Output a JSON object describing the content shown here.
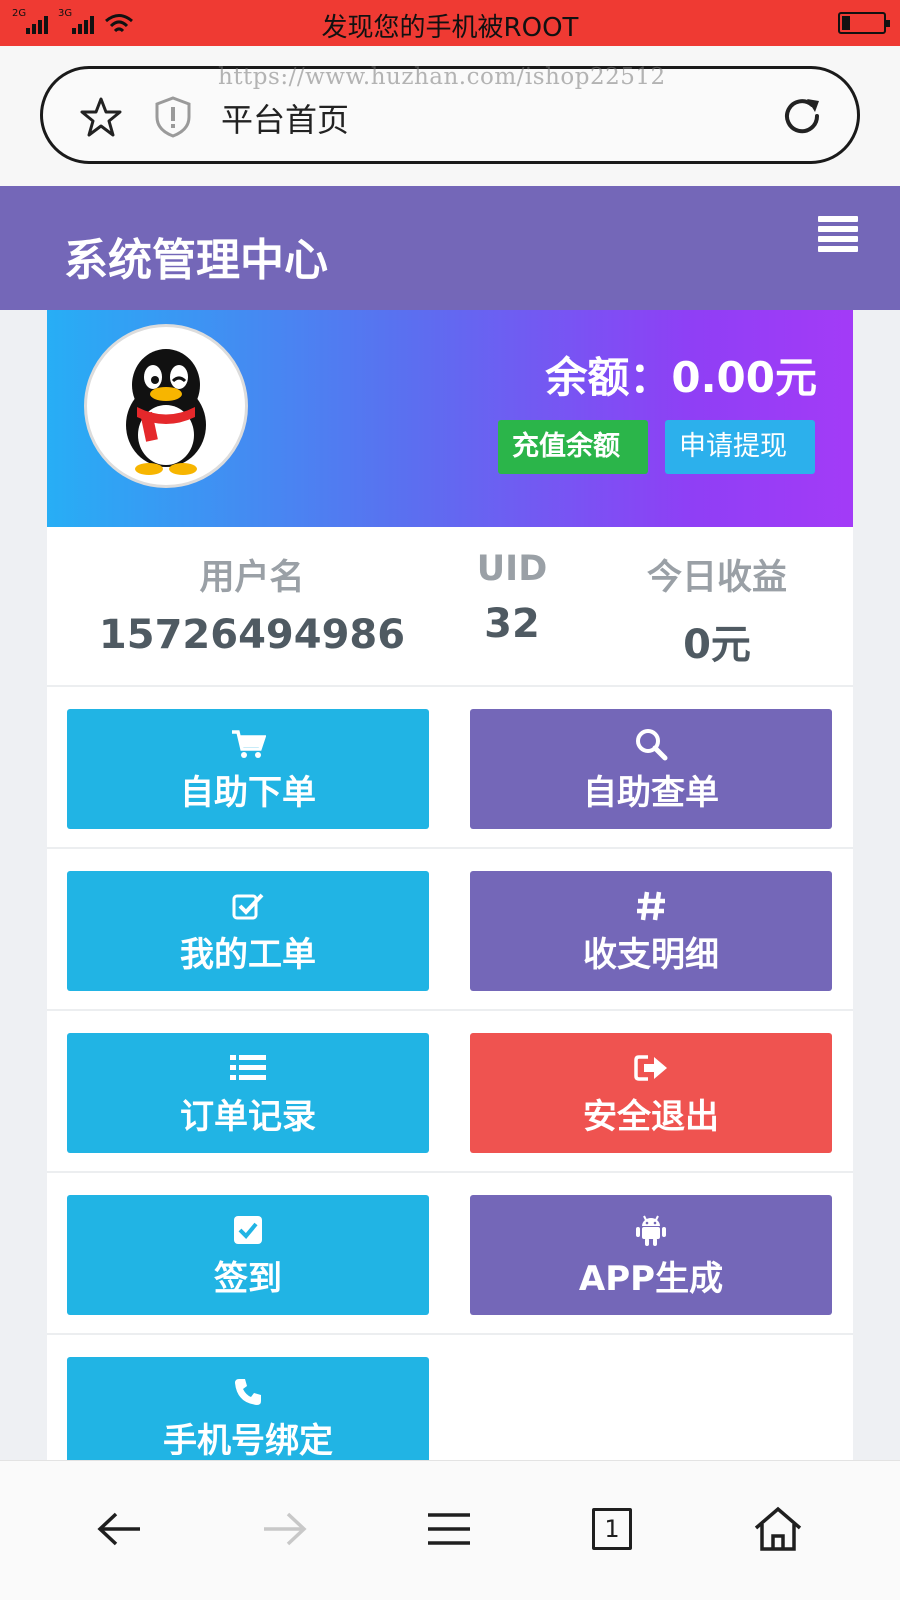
{
  "status_bar": {
    "signal1_tag": "2G",
    "signal2_tag": "3G",
    "notice": "发现您的手机被ROOT"
  },
  "browser": {
    "watermark": "https://www.huzhan.com/ishop22512",
    "page_title": "平台首页"
  },
  "app": {
    "title": "系统管理中心"
  },
  "profile": {
    "balance_label": "余额：0.00元",
    "recharge_label": "充值余额",
    "withdraw_label": "申请提现"
  },
  "stats": {
    "username_label": "用户名",
    "username_value": "15726494986",
    "uid_label": "UID",
    "uid_value": "32",
    "income_label": "今日收益",
    "income_value": "0元"
  },
  "tiles": [
    {
      "label": "自助下单",
      "icon": "cart-icon",
      "color": "#21b4e4"
    },
    {
      "label": "自助查单",
      "icon": "search-icon",
      "color": "#7467b8"
    },
    {
      "label": "我的工单",
      "icon": "check-square-icon",
      "color": "#21b4e4"
    },
    {
      "label": "收支明细",
      "icon": "hashtag-icon",
      "color": "#7467b8"
    },
    {
      "label": "订单记录",
      "icon": "list-icon",
      "color": "#21b4e4"
    },
    {
      "label": "安全退出",
      "icon": "sign-out-icon",
      "color": "#ef5350"
    },
    {
      "label": "签到",
      "icon": "checkbox-icon",
      "color": "#21b4e4"
    },
    {
      "label": "APP生成",
      "icon": "android-icon",
      "color": "#7467b8"
    },
    {
      "label": "手机号绑定",
      "icon": "phone-icon",
      "color": "#21b4e4"
    }
  ],
  "bottom_nav": {
    "tab_count": "1"
  },
  "colors": {
    "status_bar": "#ef3a33",
    "header": "#7467b8",
    "blue": "#21b4e4",
    "purple": "#7467b8",
    "red": "#ef5350",
    "green": "#2bb54a"
  }
}
